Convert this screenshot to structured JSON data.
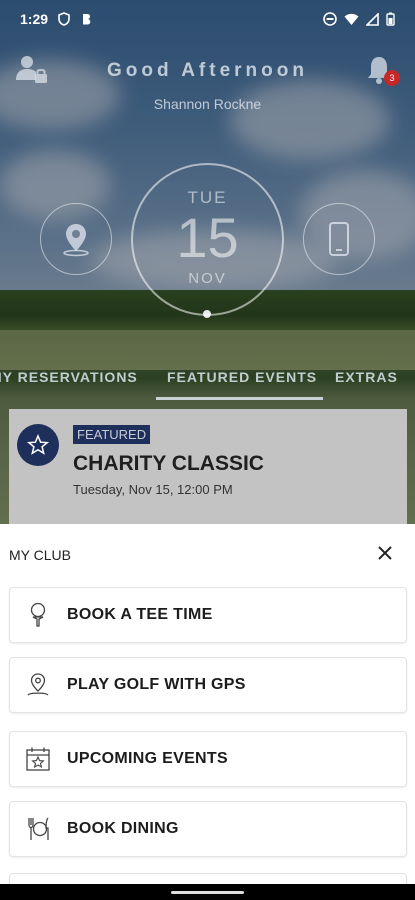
{
  "status_bar": {
    "time": "1:29"
  },
  "header": {
    "greeting": "Good Afternoon",
    "user_name": "Shannon Rockne",
    "notification_count": "3"
  },
  "date": {
    "day_of_week": "TUE",
    "day": "15",
    "month": "NOV"
  },
  "tabs": [
    {
      "label": "MY RESERVATIONS",
      "active": false
    },
    {
      "label": "FEATURED EVENTS",
      "active": true
    },
    {
      "label": "EXTRAS",
      "active": false
    }
  ],
  "featured_event": {
    "tag": "FEATURED",
    "title": "CHARITY CLASSIC",
    "datetime": "Tuesday, Nov 15, 12:00 PM"
  },
  "sheet": {
    "title": "MY CLUB",
    "items": [
      {
        "label": "BOOK A TEE TIME",
        "icon": "golf-tee-icon"
      },
      {
        "label": "PLAY GOLF WITH GPS",
        "icon": "map-pin-icon"
      },
      {
        "label": "UPCOMING EVENTS",
        "icon": "calendar-star-icon"
      },
      {
        "label": "BOOK DINING",
        "icon": "dining-icon"
      }
    ]
  },
  "colors": {
    "accent_navy": "#1f2f5c",
    "badge_red": "#c62828"
  }
}
